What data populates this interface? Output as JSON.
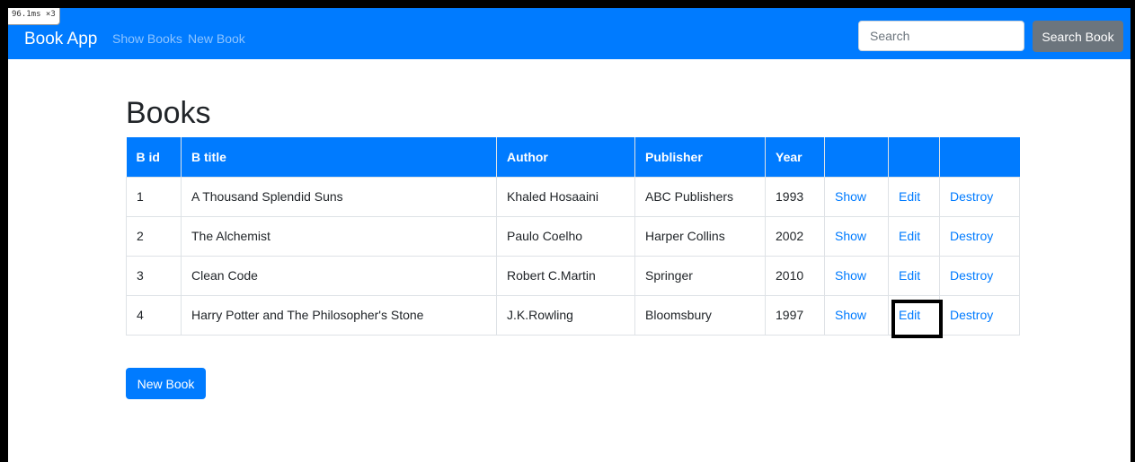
{
  "perf_badge": "96.1ms ×3",
  "navbar": {
    "brand": "Book App",
    "links": [
      "Show Books",
      "New Book"
    ],
    "search_placeholder": "Search",
    "search_button": "Search Book"
  },
  "page": {
    "title": "Books",
    "new_button": "New Book"
  },
  "table": {
    "headers": [
      "B id",
      "B title",
      "Author",
      "Publisher",
      "Year"
    ],
    "rows": [
      {
        "id": "1",
        "title": "A Thousand Splendid Suns",
        "author": "Khaled Hosaaini",
        "publisher": "ABC Publishers",
        "year": "1993",
        "show": "Show",
        "edit": "Edit",
        "destroy": "Destroy"
      },
      {
        "id": "2",
        "title": "The Alchemist",
        "author": "Paulo Coelho",
        "publisher": "Harper Collins",
        "year": "2002",
        "show": "Show",
        "edit": "Edit",
        "destroy": "Destroy"
      },
      {
        "id": "3",
        "title": "Clean Code",
        "author": "Robert C.Martin",
        "publisher": "Springer",
        "year": "2010",
        "show": "Show",
        "edit": "Edit",
        "destroy": "Destroy"
      },
      {
        "id": "4",
        "title": "Harry Potter and The Philosopher's Stone",
        "author": "J.K.Rowling",
        "publisher": "Bloomsbury",
        "year": "1997",
        "show": "Show",
        "edit": "Edit",
        "destroy": "Destroy"
      }
    ]
  },
  "colors": {
    "primary": "#007bff",
    "secondary": "#6c757d",
    "text": "#212529"
  }
}
